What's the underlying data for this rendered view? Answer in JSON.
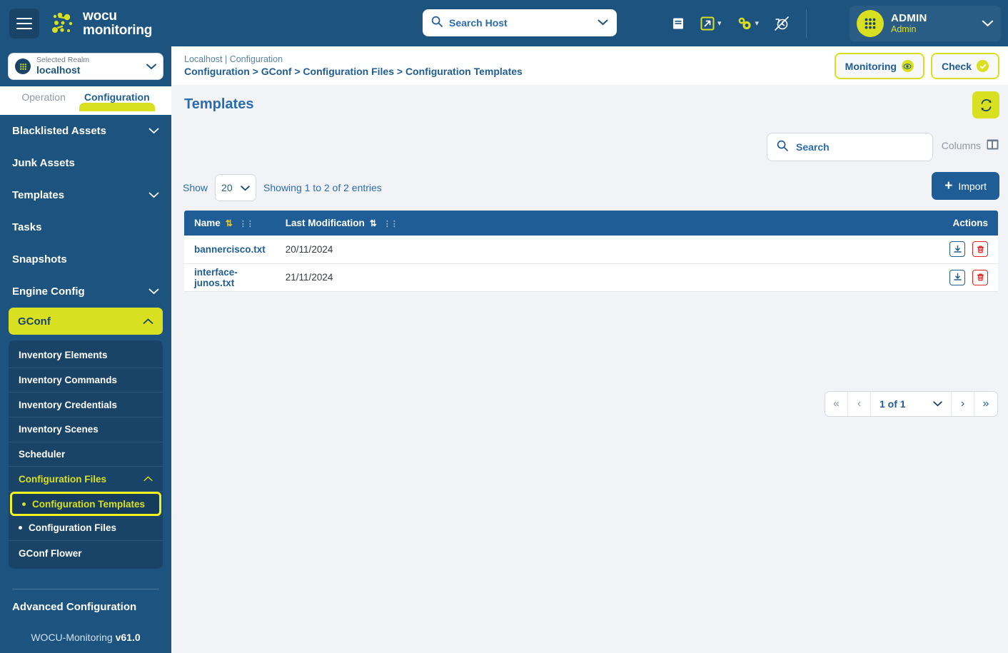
{
  "topbar": {
    "menu_icon": "hamburger-icon",
    "brand_line1": "wocu",
    "brand_line2": "monitoring",
    "host_search_placeholder": "Search Host",
    "icons": [
      {
        "name": "report-icon",
        "label": "Reports"
      },
      {
        "name": "external-link-icon",
        "label": "Open external"
      },
      {
        "name": "settings-gear-icon",
        "label": "Settings"
      },
      {
        "name": "auto-refresh-off-icon",
        "label": "Auto refresh disabled"
      }
    ],
    "user": {
      "name": "ADMIN",
      "role": "Admin"
    }
  },
  "breadcrumb": {
    "top": "Localhost | Configuration",
    "path": "Configuration > GConf > Configuration Files > Configuration Templates",
    "actions": [
      {
        "label": "Monitoring",
        "icon": "eye-icon"
      },
      {
        "label": "Check",
        "icon": "check-icon"
      }
    ]
  },
  "sidebar": {
    "realm": {
      "caption": "Selected Realm",
      "value": "localhost"
    },
    "tabs": [
      {
        "label": "Operation",
        "active": false
      },
      {
        "label": "Configuration",
        "active": true
      }
    ],
    "nav": [
      {
        "label": "Blacklisted Assets",
        "expandable": true
      },
      {
        "label": "Junk Assets",
        "expandable": false
      },
      {
        "label": "Templates",
        "expandable": true
      },
      {
        "label": "Tasks",
        "expandable": false
      },
      {
        "label": "Snapshots",
        "expandable": false
      },
      {
        "label": "Engine Config",
        "expandable": true
      },
      {
        "label": "GConf",
        "expandable": true,
        "active": true
      }
    ],
    "submenu": [
      {
        "label": "Inventory Elements"
      },
      {
        "label": "Inventory Commands"
      },
      {
        "label": "Inventory Credentials"
      },
      {
        "label": "Inventory Scenes"
      },
      {
        "label": "Scheduler"
      },
      {
        "label": "Configuration Files",
        "expanded": true
      },
      {
        "label": "Configuration Templates",
        "leaf": true,
        "selected": true
      },
      {
        "label": "Configuration Files",
        "leaf": true,
        "selected": false
      },
      {
        "label": "GConf Flower"
      }
    ],
    "advanced": "Advanced Configuration",
    "version_label": "WOCU-Monitoring",
    "version_value": "v61.0"
  },
  "main": {
    "title": "Templates",
    "refresh_icon": "refresh-icon",
    "search_placeholder": "Search",
    "columns_label": "Columns",
    "show_label": "Show",
    "page_length": "20",
    "entries_text": "Showing 1 to 2 of 2 entries",
    "import_label": "Import",
    "table": {
      "columns": [
        "Name",
        "Last Modification",
        "Actions"
      ],
      "sort_column": "Name",
      "rows": [
        {
          "name": "bannercisco.txt",
          "last_modification": "20/11/2024"
        },
        {
          "name": "interface-junos.txt",
          "last_modification": "21/11/2024"
        }
      ],
      "row_actions": [
        {
          "name": "download-icon",
          "label": "Download"
        },
        {
          "name": "delete-icon",
          "label": "Delete"
        }
      ]
    },
    "pagination": {
      "first": "«",
      "prev": "‹",
      "current": "1 of 1",
      "next": "›",
      "last": "»"
    }
  },
  "colors": {
    "primary_blue": "#1d537f",
    "dark_blue": "#1a4467",
    "accent_yellow": "#d9e021",
    "table_header": "#1f5d96",
    "danger_red": "#e02424"
  }
}
